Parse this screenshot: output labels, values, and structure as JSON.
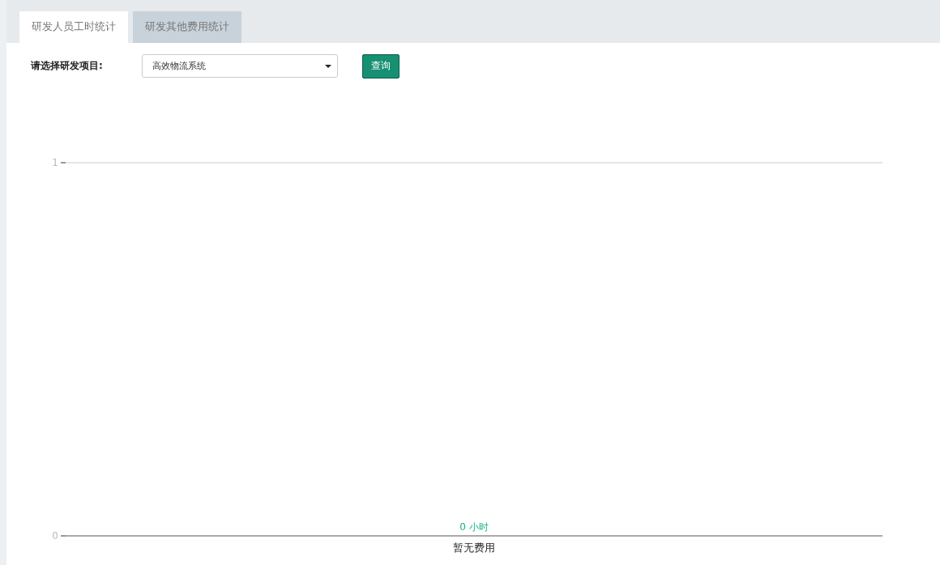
{
  "tabs": [
    {
      "label": "研发人员工时统计",
      "selected": true
    },
    {
      "label": "研发其他费用统计",
      "selected": false
    }
  ],
  "filter": {
    "label": "请选择研发项目:",
    "select_value": "高效物流系统",
    "query_button": "查询"
  },
  "chart_data": {
    "type": "bar",
    "categories": [
      "暂无费用"
    ],
    "values": [
      0
    ],
    "ylim": [
      0,
      1
    ],
    "yticks": [
      0,
      1
    ],
    "value_labels": [
      "0 小时"
    ]
  }
}
